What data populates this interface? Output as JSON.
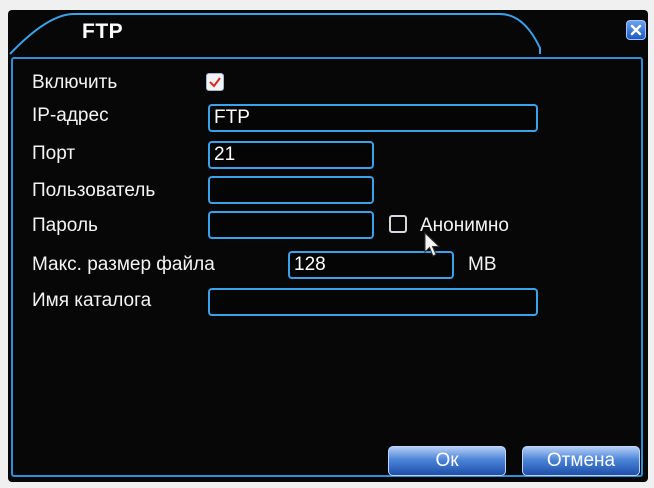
{
  "window": {
    "title": "FTP",
    "close_icon": "close-icon"
  },
  "form": {
    "enable": {
      "label": "Включить",
      "checked": true
    },
    "ip": {
      "label": "IP-адрес",
      "value": "FTP"
    },
    "port": {
      "label": "Порт",
      "value": "21"
    },
    "user": {
      "label": "Пользователь",
      "value": ""
    },
    "password": {
      "label": "Пароль",
      "value": ""
    },
    "anonymous": {
      "label": "Анонимно",
      "checked": false
    },
    "max_size": {
      "label": "Макс. размер файла",
      "value": "128",
      "unit": "MB"
    },
    "directory": {
      "label": "Имя каталога",
      "value": ""
    }
  },
  "buttons": {
    "ok": "Ок",
    "cancel": "Отмена"
  },
  "colors": {
    "background": "#070708",
    "accent_border": "#3aa2ea",
    "button_gradient_top": "#b4cdf6",
    "button_gradient_bottom": "#1d4fa8"
  }
}
